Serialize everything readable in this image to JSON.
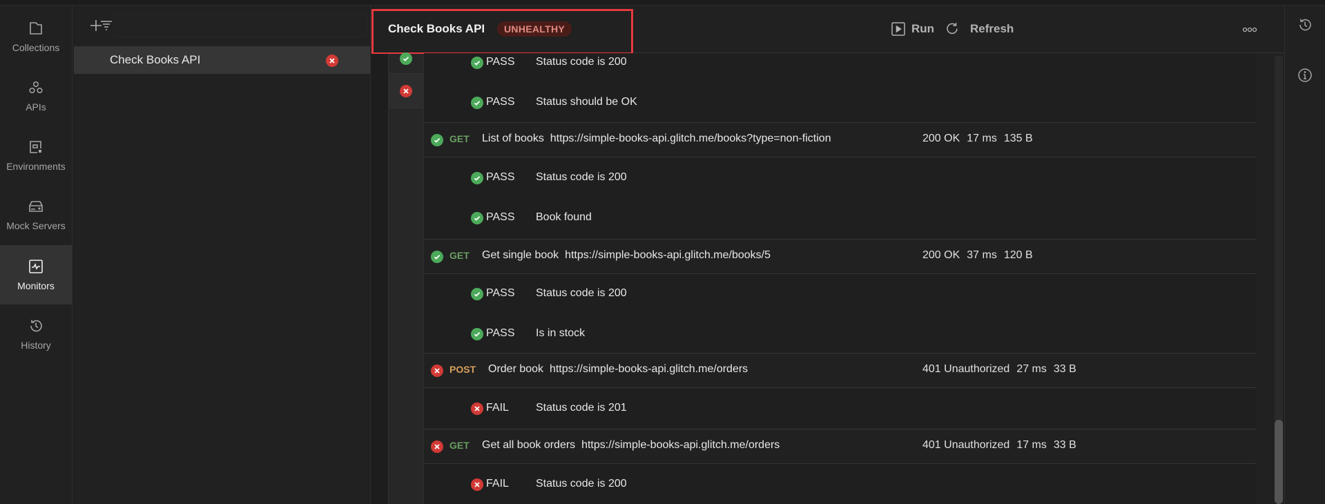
{
  "nav": {
    "items": [
      {
        "label": "Collections",
        "icon": "collections-icon"
      },
      {
        "label": "APIs",
        "icon": "apis-icon"
      },
      {
        "label": "Environments",
        "icon": "environments-icon"
      },
      {
        "label": "Mock Servers",
        "icon": "mock-servers-icon"
      },
      {
        "label": "Monitors",
        "icon": "monitors-icon",
        "active": true
      },
      {
        "label": "History",
        "icon": "history-icon"
      }
    ]
  },
  "sidebar": {
    "monitors": [
      {
        "name": "Check Books API",
        "status": "fail"
      }
    ]
  },
  "header": {
    "title": "Check Books API",
    "status_badge": "UNHEALTHY",
    "run_label": "Run",
    "refresh_label": "Refresh"
  },
  "colors": {
    "pass": "#4caa5a",
    "fail": "#d23a36",
    "get": "#6a9e63",
    "post": "#d9a05b",
    "badge_bg": "#4a1c18",
    "badge_text": "#e08a80",
    "highlight": "#e5393f"
  },
  "run_history": [
    {
      "status": "pass"
    },
    {
      "status": "fail",
      "selected": true
    }
  ],
  "results": {
    "top_tests": [
      {
        "result": "PASS",
        "name": "Status code is 200",
        "status": "pass"
      },
      {
        "result": "PASS",
        "name": "Status should be OK",
        "status": "pass"
      }
    ],
    "requests": [
      {
        "status": "pass",
        "method": "GET",
        "name": "List of books",
        "url": "https://simple-books-api.glitch.me/books?type=non-fiction",
        "code": "200 OK",
        "time": "17 ms",
        "size": "135 B",
        "tests": [
          {
            "result": "PASS",
            "name": "Status code is 200",
            "status": "pass"
          },
          {
            "result": "PASS",
            "name": "Book found",
            "status": "pass"
          }
        ]
      },
      {
        "status": "pass",
        "method": "GET",
        "name": "Get single book",
        "url": "https://simple-books-api.glitch.me/books/5",
        "code": "200 OK",
        "time": "37 ms",
        "size": "120 B",
        "tests": [
          {
            "result": "PASS",
            "name": "Status code is 200",
            "status": "pass"
          },
          {
            "result": "PASS",
            "name": "Is in stock",
            "status": "pass"
          }
        ]
      },
      {
        "status": "fail",
        "method": "POST",
        "name": "Order book",
        "url": "https://simple-books-api.glitch.me/orders",
        "code": "401 Unauthorized",
        "time": "27 ms",
        "size": "33 B",
        "tests": [
          {
            "result": "FAIL",
            "name": "Status code is 201",
            "status": "fail"
          }
        ]
      },
      {
        "status": "fail",
        "method": "GET",
        "name": "Get all book orders",
        "url": "https://simple-books-api.glitch.me/orders",
        "code": "401 Unauthorized",
        "time": "17 ms",
        "size": "33 B",
        "tests": [
          {
            "result": "FAIL",
            "name": "Status code is 200",
            "status": "fail"
          }
        ]
      }
    ]
  }
}
